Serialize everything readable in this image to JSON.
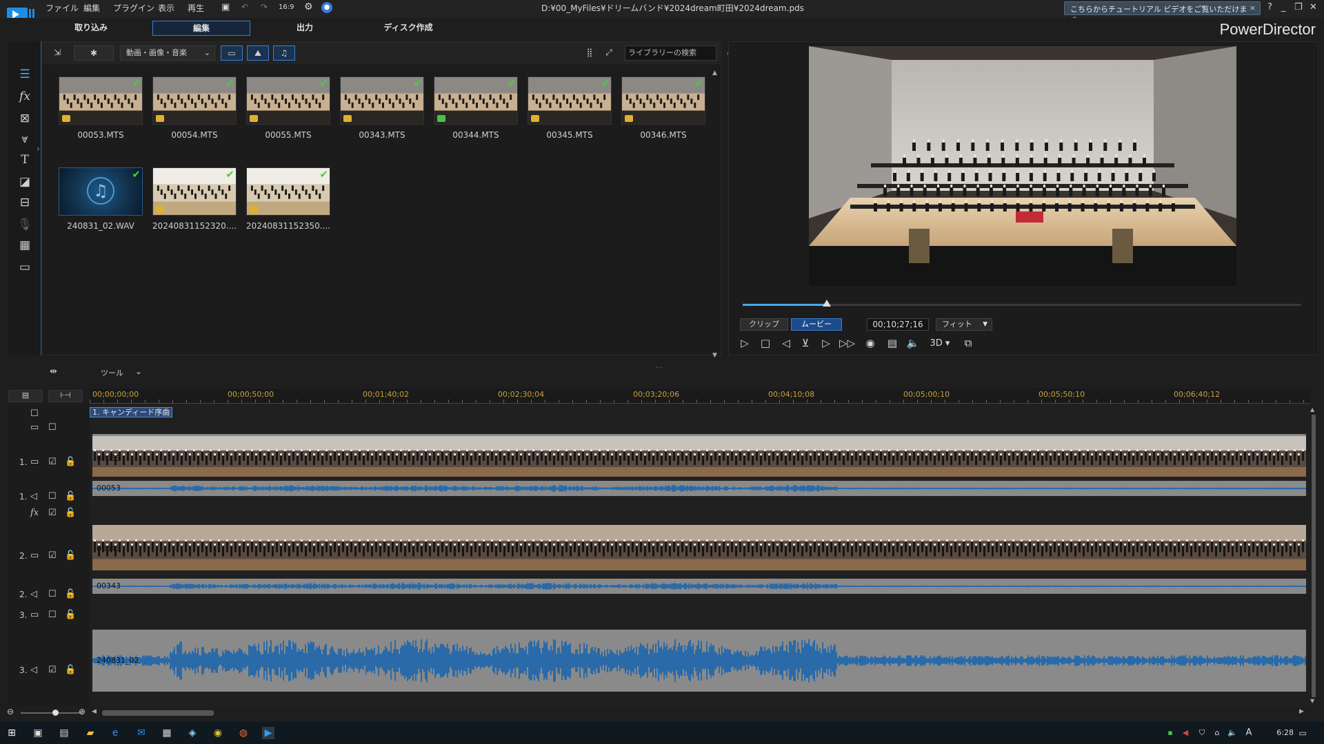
{
  "window": {
    "menu": [
      "ファイル",
      "編集",
      "プラグイン",
      "表示",
      "再生"
    ],
    "aspect": "16:9",
    "title": "D:¥00_MyFiles¥ドリームバンド¥2024dream町田¥2024dream.pds",
    "tutorial_banner": "こちらからチュートリアル ビデオをご覧いただけます。",
    "controls": [
      "?",
      "_",
      "❐",
      "✕"
    ]
  },
  "mode_tabs": [
    "取り込み",
    "編集",
    "出力",
    "ディスク作成"
  ],
  "active_mode": "編集",
  "brand": "PowerDirector",
  "library": {
    "filter": "動画・画像・音楽",
    "search_placeholder": "ライブラリーの検索",
    "items": [
      {
        "name": "00053.MTS",
        "type": "video",
        "used": true
      },
      {
        "name": "00054.MTS",
        "type": "video",
        "used": true
      },
      {
        "name": "00055.MTS",
        "type": "video",
        "used": true
      },
      {
        "name": "00343.MTS",
        "type": "video",
        "used": true
      },
      {
        "name": "00344.MTS",
        "type": "video",
        "used": true
      },
      {
        "name": "00345.MTS",
        "type": "video",
        "used": true
      },
      {
        "name": "00346.MTS",
        "type": "video",
        "used": true
      },
      {
        "name": "240831_02.WAV",
        "type": "audio",
        "used": true
      },
      {
        "name": "20240831152320....",
        "type": "image",
        "used": true
      },
      {
        "name": "20240831152350....",
        "type": "image",
        "used": true
      }
    ]
  },
  "preview": {
    "mode_clip": "クリップ",
    "mode_movie": "ムービー",
    "active_mode": "ムービー",
    "timecode": "00;10;27;16",
    "fit": "フィット",
    "playhead_fraction": 0.151,
    "stereo": "3D"
  },
  "timeline": {
    "tools_label": "ツール",
    "ruler": [
      "00;00;00;00",
      "00;00;50;00",
      "00;01;40;02",
      "00;02;30;04",
      "00;03;20;06",
      "00;04;10;08",
      "00;05;00;10",
      "00;05;50;10",
      "00;06;40;12"
    ],
    "chapter": "1. キャンディード序曲",
    "tracks": {
      "v1": {
        "num": "1.",
        "clip": "00053"
      },
      "a1": {
        "num": "1.",
        "clip": "00053"
      },
      "v2": {
        "num": "2.",
        "clip": "00343"
      },
      "a2": {
        "num": "2.",
        "clip": "00343"
      },
      "v3": {
        "num": "3."
      },
      "a3": {
        "num": "3.",
        "clip": "240831_02"
      }
    }
  },
  "taskbar": {
    "clock": "6:28",
    "ime": "A"
  },
  "colors": {
    "accent": "#3c7fd1",
    "check": "#38d838",
    "waveform": "#2a6aa8"
  }
}
